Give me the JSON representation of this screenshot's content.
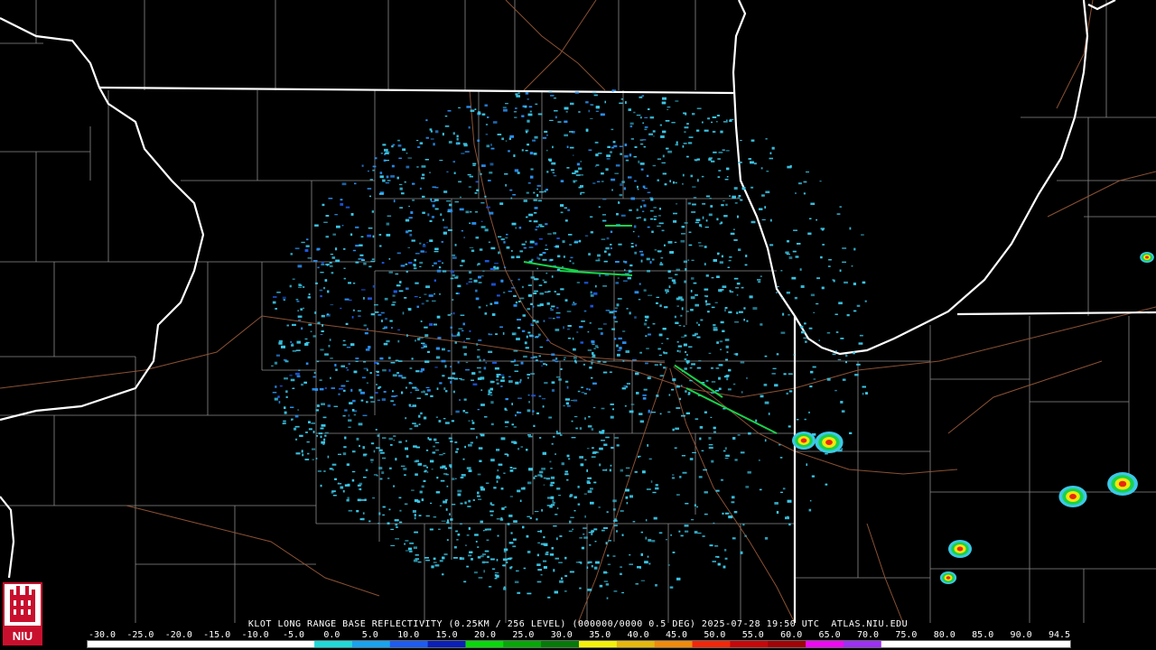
{
  "product": {
    "title": "KLOT LONG RANGE BASE REFLECTIVITY (0.25KM / 256 LEVEL) (000000/0000 0.5 DEG) 2025-07-28 19:50 UTC  ATLAS.NIU.EDU"
  },
  "logo": {
    "text": "NIU",
    "color": "#c8102e"
  },
  "scale": {
    "unit_values": [
      "-30.0",
      "-25.0",
      "-20.0",
      "-15.0",
      "-10.0",
      "-5.0",
      "0.0",
      "5.0",
      "10.0",
      "15.0",
      "20.0",
      "25.0",
      "30.0",
      "35.0",
      "40.0",
      "45.0",
      "50.0",
      "55.0",
      "60.0",
      "65.0",
      "70.0",
      "75.0",
      "80.0",
      "85.0",
      "90.0",
      "94.5"
    ],
    "colors": [
      "#ffffff",
      "#ffffff",
      "#ffffff",
      "#ffffff",
      "#ffffff",
      "#ffffff",
      "#1fd9d9",
      "#17a3f0",
      "#1d5cf2",
      "#0a1fb8",
      "#07d90a",
      "#05a806",
      "#067a08",
      "#f5f20a",
      "#e6b80b",
      "#f08a0b",
      "#f2270a",
      "#c8070a",
      "#a10306",
      "#f008f5",
      "#9e2ff5",
      "#ffffff",
      "#ffffff",
      "#ffffff",
      "#ffffff",
      "#ffffff"
    ]
  },
  "map_colors": {
    "state_border": "#ffffff",
    "county_border": "#8a8a8a",
    "highway": "#9a5a3a",
    "echo_light": "#3cc8e8",
    "echo_mid": "#2a8ff0",
    "echo_strong": "#1e5ae6",
    "echo_green": "#19d24b",
    "storm_yellow": "#f2e60a",
    "storm_red": "#e8280a"
  }
}
